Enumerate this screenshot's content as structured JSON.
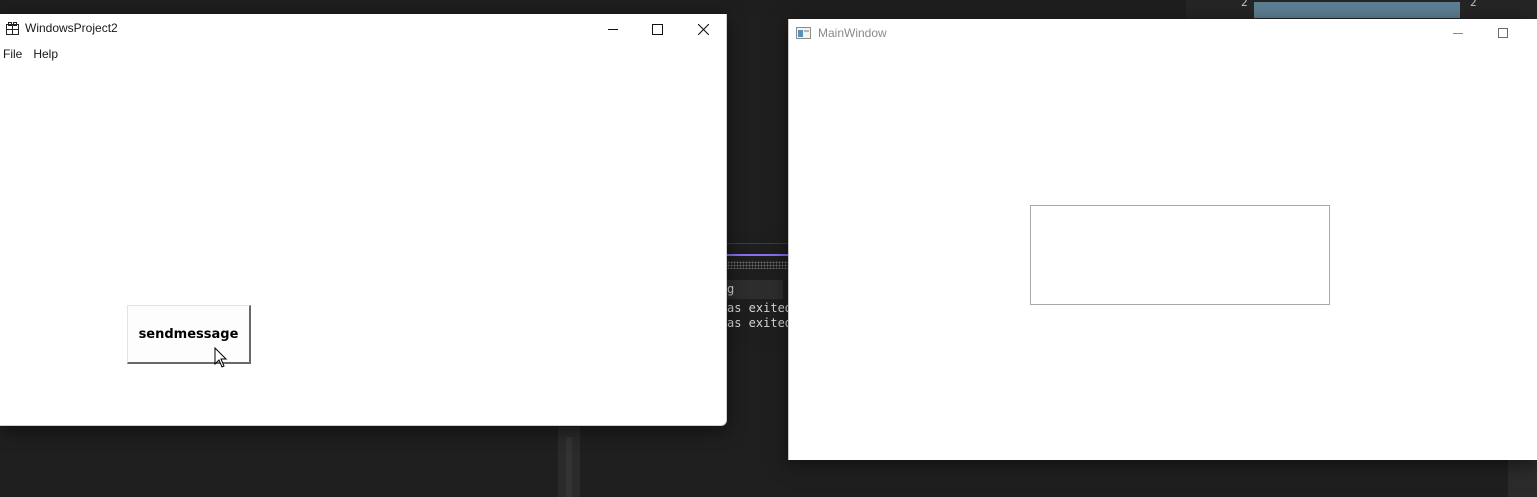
{
  "window1": {
    "title": "WindowsProject2",
    "icon": "app-window-icon",
    "controls": {
      "minimize": "minimize-icon",
      "maximize": "maximize-icon",
      "close": "close-icon"
    },
    "menu": [
      {
        "label": "File"
      },
      {
        "label": "Help"
      }
    ],
    "button_label": "sendmessage"
  },
  "window2": {
    "title": "MainWindow",
    "icon": "app-window-icon",
    "controls": {
      "minimize": "minimize-icon",
      "maximize": "maximize-icon"
    },
    "text_box_value": ""
  },
  "background": {
    "output_lines": [
      "g",
      "as exited",
      "as exited"
    ],
    "right_numbers": [
      "2",
      "2"
    ]
  },
  "colors": {
    "desktop": "#1f1f1f",
    "window": "#ffffff",
    "accent_line": "#8a6df0",
    "progress_bar": "#5d7f93"
  }
}
